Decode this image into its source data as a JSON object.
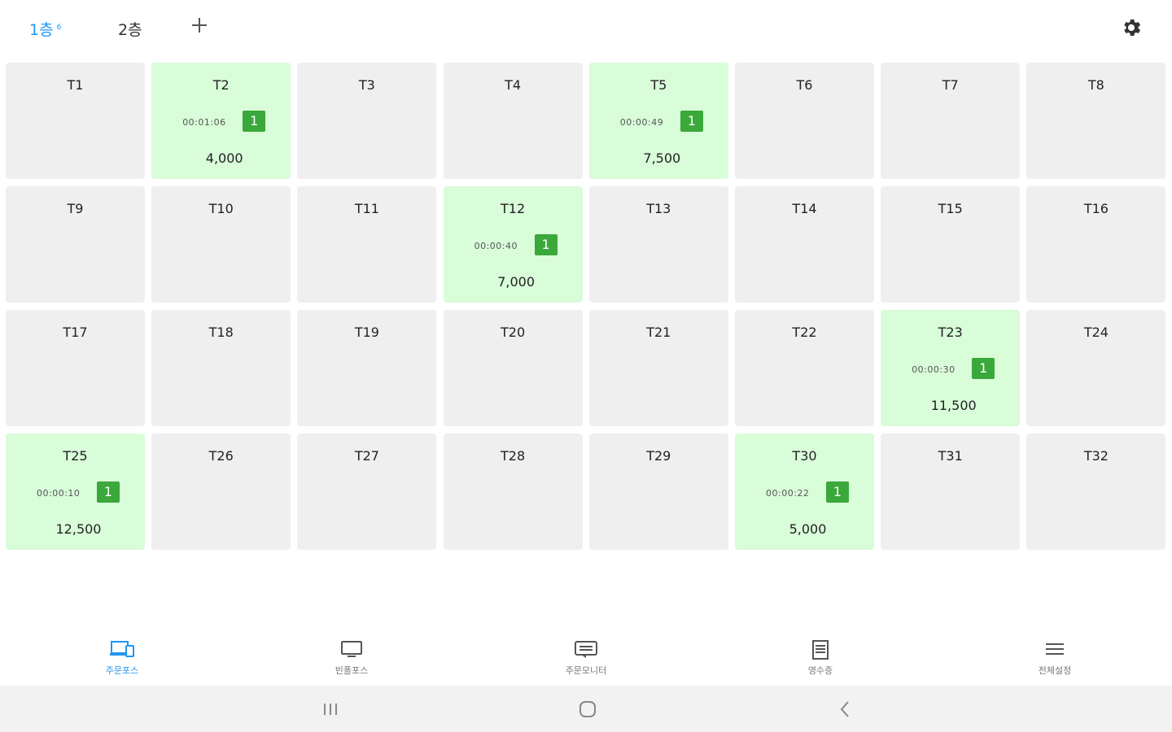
{
  "topbar": {
    "tabs": [
      {
        "label": "1층",
        "count": "6",
        "active": true
      },
      {
        "label": "2층",
        "count": "",
        "active": false
      }
    ],
    "add_icon": "plus-icon",
    "settings_icon": "gear-icon"
  },
  "colors": {
    "accent": "#2196f3",
    "occupied_bg": "#d9fcd9",
    "empty_bg": "#efefef",
    "count_badge": "#3aa83a"
  },
  "tables": [
    {
      "name": "T1",
      "occupied": false
    },
    {
      "name": "T2",
      "occupied": true,
      "time": "00:01:06",
      "count": "1",
      "amount": "4,000"
    },
    {
      "name": "T3",
      "occupied": false
    },
    {
      "name": "T4",
      "occupied": false
    },
    {
      "name": "T5",
      "occupied": true,
      "time": "00:00:49",
      "count": "1",
      "amount": "7,500"
    },
    {
      "name": "T6",
      "occupied": false
    },
    {
      "name": "T7",
      "occupied": false
    },
    {
      "name": "T8",
      "occupied": false
    },
    {
      "name": "T9",
      "occupied": false
    },
    {
      "name": "T10",
      "occupied": false
    },
    {
      "name": "T11",
      "occupied": false
    },
    {
      "name": "T12",
      "occupied": true,
      "time": "00:00:40",
      "count": "1",
      "amount": "7,000"
    },
    {
      "name": "T13",
      "occupied": false
    },
    {
      "name": "T14",
      "occupied": false
    },
    {
      "name": "T15",
      "occupied": false
    },
    {
      "name": "T16",
      "occupied": false
    },
    {
      "name": "T17",
      "occupied": false
    },
    {
      "name": "T18",
      "occupied": false
    },
    {
      "name": "T19",
      "occupied": false
    },
    {
      "name": "T20",
      "occupied": false
    },
    {
      "name": "T21",
      "occupied": false
    },
    {
      "name": "T22",
      "occupied": false
    },
    {
      "name": "T23",
      "occupied": true,
      "time": "00:00:30",
      "count": "1",
      "amount": "11,500"
    },
    {
      "name": "T24",
      "occupied": false
    },
    {
      "name": "T25",
      "occupied": true,
      "time": "00:00:10",
      "count": "1",
      "amount": "12,500"
    },
    {
      "name": "T26",
      "occupied": false
    },
    {
      "name": "T27",
      "occupied": false
    },
    {
      "name": "T28",
      "occupied": false
    },
    {
      "name": "T29",
      "occupied": false
    },
    {
      "name": "T30",
      "occupied": true,
      "time": "00:00:22",
      "count": "1",
      "amount": "5,000"
    },
    {
      "name": "T31",
      "occupied": false
    },
    {
      "name": "T32",
      "occupied": false
    }
  ],
  "bottom_nav": [
    {
      "label": "주문포스",
      "icon": "devices-icon",
      "active": true
    },
    {
      "label": "빈폴포스",
      "icon": "monitor-icon",
      "active": false
    },
    {
      "label": "주문모니터",
      "icon": "message-board-icon",
      "active": false
    },
    {
      "label": "영수증",
      "icon": "receipt-icon",
      "active": false
    },
    {
      "label": "전체설정",
      "icon": "menu-icon",
      "active": false
    }
  ],
  "system_nav": {
    "recent_icon": "recent-apps-icon",
    "home_icon": "home-icon",
    "back_icon": "back-icon"
  }
}
